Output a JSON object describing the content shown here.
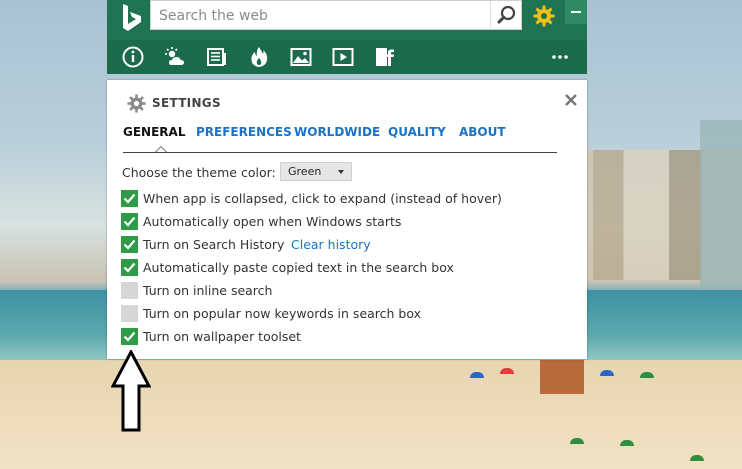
{
  "search": {
    "placeholder": "Search the web"
  },
  "toolbar": {
    "icons": [
      "info-icon",
      "weather-icon",
      "news-icon",
      "trending-icon",
      "image-icon",
      "video-icon",
      "facebook-icon",
      "more-icon"
    ]
  },
  "settings": {
    "title": "SETTINGS",
    "tabs": [
      {
        "label": "GENERAL",
        "active": true
      },
      {
        "label": "PREFERENCES",
        "active": false
      },
      {
        "label": "WORLDWIDE",
        "active": false
      },
      {
        "label": "QUALITY",
        "active": false
      },
      {
        "label": "ABOUT",
        "active": false
      }
    ],
    "theme_label": "Choose the theme color:",
    "theme_value": "Green",
    "options": [
      {
        "label": "When app is collapsed, click to expand (instead of hover)",
        "checked": true
      },
      {
        "label": "Automatically open when Windows starts",
        "checked": true
      },
      {
        "label": "Turn on Search History",
        "checked": true,
        "link": "Clear history"
      },
      {
        "label": "Automatically paste copied text in the search box",
        "checked": true
      },
      {
        "label": "Turn on inline search",
        "checked": false
      },
      {
        "label": "Turn on popular now keywords in search box",
        "checked": false
      },
      {
        "label": "Turn on wallpaper toolset",
        "checked": true
      }
    ]
  },
  "colors": {
    "bar": "#1f7353",
    "accent_gear": "#f2c21b",
    "checkbox_on": "#2e9b47",
    "checkbox_off": "#d6d6d6",
    "link": "#1a73c4"
  }
}
